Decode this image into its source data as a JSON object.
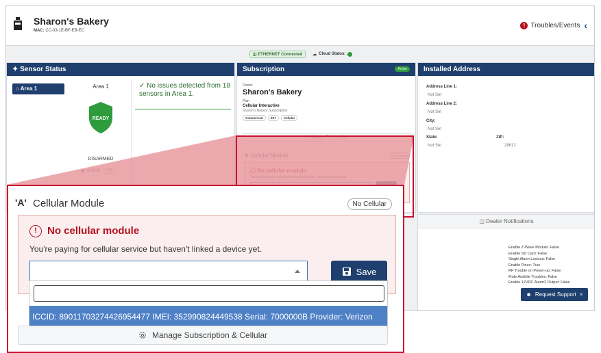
{
  "header": {
    "title": "Sharon's Bakery",
    "mac_label": "MAC:",
    "mac_value": "CC-03-1E-BF-EB-EC",
    "troubles_label": "Troubles/Events"
  },
  "status": {
    "ethernet": "ETHERNET Connected",
    "cloud": "Cloud Status:"
  },
  "sensor_status": {
    "title": "Sensor Status",
    "area_pill": "Area 1",
    "area_title": "Area 1",
    "shield_text": "READY",
    "state": "DISARMED",
    "chime_label": "CHIME",
    "chime_state": "OFF",
    "no_issues": "No issues detected from 18 sensors in Area 1."
  },
  "subscription": {
    "title": "Subscription",
    "active_badge": "Active",
    "owner_label": "Owner",
    "owner_value": "Sharon's Bakery",
    "plan_label": "Plan",
    "plan_value": "Cellular Interactive",
    "plan_sub": "Sharon's Bakery Subscription",
    "tags": [
      "Commercial",
      "E27",
      "Cellular"
    ],
    "manage_label": "Manage Subscription"
  },
  "cellular_mini": {
    "title": "Cellular Module",
    "badge": "No Cellular",
    "error_title": "No cellular module",
    "error_msg": "You're paying for cellular service but haven't linked a device yet."
  },
  "address": {
    "title": "Installed Address",
    "line1_label": "Address Line 1:",
    "line1_value": "Not Set",
    "line2_label": "Address Line 2:",
    "line2_value": "Not Set",
    "city_label": "City:",
    "city_value": "Not Set",
    "state_label": "State:",
    "state_value": "Not Set",
    "zip_label": "ZIP:",
    "zip_value": "28612"
  },
  "dealer": {
    "title": "Dealer Notifications",
    "items": [
      "Enable Z-Wave Module: False",
      "Enable SD Card: False",
      "Single Alarm Lockout: False",
      "Enable Piezo: True",
      "RF Trouble on Power-up: False",
      "Mute Audible Troubles: False",
      "Enable 12VDC Alarm2 Output: False"
    ]
  },
  "request_support": "Request Support",
  "zoom": {
    "antenna_glyph": "'A'",
    "title": "Cellular Module",
    "badge": "No Cellular",
    "error_title": "No cellular module",
    "error_msg": "You're paying for cellular service but haven't linked a device yet.",
    "save_label": "Save",
    "dropdown_option": "ICCID: 89011703274426954477 IMEI: 352990824449538 Serial: 7000000B Provider: Verizon",
    "manage_label": "Manage Subscription & Cellular"
  },
  "colors": {
    "navy": "#1f3f6e",
    "error_red": "#b3121f",
    "callout_red": "#c8102e",
    "ok_green": "#2e9b3c",
    "selected_blue": "#4f81c7"
  }
}
